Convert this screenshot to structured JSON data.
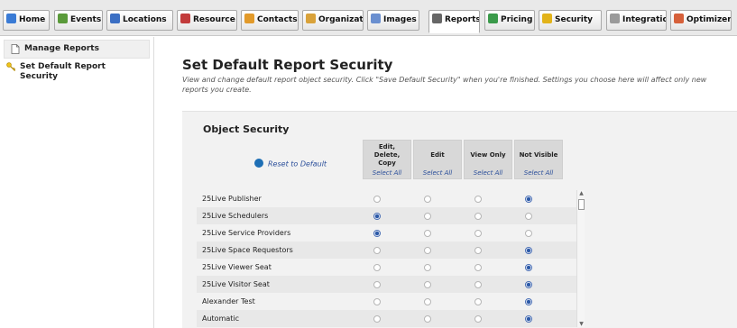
{
  "tabs": [
    {
      "label": "Home",
      "icon": "home-icon"
    },
    {
      "label": "Events",
      "icon": "events-icon"
    },
    {
      "label": "Locations",
      "icon": "locations-icon"
    },
    {
      "label": "Resource",
      "icon": "resource-icon"
    },
    {
      "label": "Contacts",
      "icon": "contacts-icon"
    },
    {
      "label": "Organizat",
      "icon": "organizations-icon"
    },
    {
      "label": "Images",
      "icon": "images-icon"
    },
    {
      "label": "Reports",
      "icon": "reports-icon",
      "active": true
    },
    {
      "label": "Pricing",
      "icon": "pricing-icon"
    },
    {
      "label": "Security",
      "icon": "security-icon"
    },
    {
      "label": "Integratic",
      "icon": "integration-icon"
    },
    {
      "label": "Optimizer",
      "icon": "optimizer-icon"
    }
  ],
  "sidebar": {
    "items": [
      {
        "label": "Manage Reports",
        "icon": "document-icon"
      },
      {
        "label": "Set Default Report Security",
        "icon": "key-icon"
      }
    ]
  },
  "main": {
    "title": "Set Default Report Security",
    "description": "View and change default report object security. Click \"Save Default Security\" when you're finished. Settings you choose here will affect only new reports you create.",
    "section_title": "Object Security",
    "reset_label": "Reset to Default",
    "columns": [
      {
        "label": "Edit, Delete, Copy",
        "select_all": "Select All"
      },
      {
        "label": "Edit",
        "select_all": "Select All"
      },
      {
        "label": "View Only",
        "select_all": "Select All"
      },
      {
        "label": "Not Visible",
        "select_all": "Select All"
      }
    ],
    "rows": [
      {
        "name": "25Live Publisher",
        "selected": 3
      },
      {
        "name": "25Live Schedulers",
        "selected": 0
      },
      {
        "name": "25Live Service Providers",
        "selected": 0
      },
      {
        "name": "25Live Space Requestors",
        "selected": 3
      },
      {
        "name": "25Live Viewer Seat",
        "selected": 3
      },
      {
        "name": "25Live Visitor Seat",
        "selected": 3
      },
      {
        "name": "Alexander Test",
        "selected": 3
      },
      {
        "name": "Automatic",
        "selected": 3
      }
    ]
  },
  "colors": {
    "accent": "#2d5aa8",
    "link": "#2a4e9a"
  }
}
